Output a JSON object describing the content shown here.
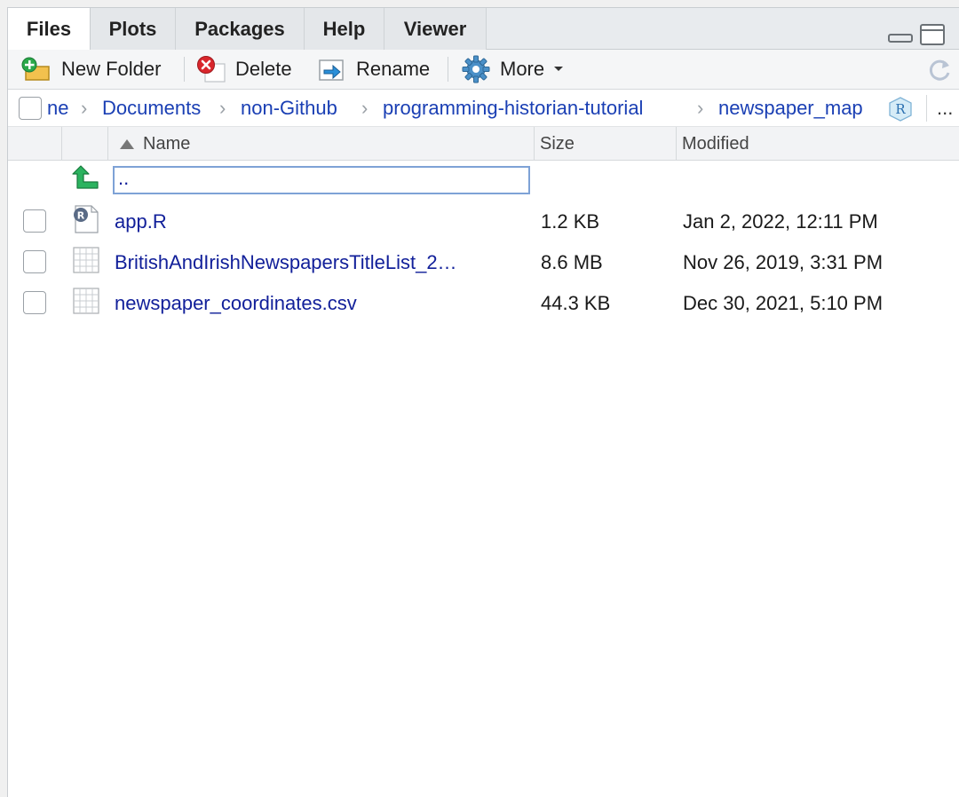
{
  "tabs": [
    {
      "label": "Files",
      "active": true
    },
    {
      "label": "Plots",
      "active": false
    },
    {
      "label": "Packages",
      "active": false
    },
    {
      "label": "Help",
      "active": false
    },
    {
      "label": "Viewer",
      "active": false
    }
  ],
  "toolbar": {
    "new_folder": "New Folder",
    "delete": "Delete",
    "rename": "Rename",
    "more": "More"
  },
  "breadcrumb": {
    "items": [
      "ne",
      "Documents",
      "non-Github",
      "programming-historian-tutorial",
      "newspaper_map"
    ],
    "overflow": "..."
  },
  "table": {
    "headers": {
      "name": "Name",
      "size": "Size",
      "modified": "Modified"
    },
    "sort_column": "Name",
    "sort_direction": "ascending",
    "parent_label": "..",
    "rows": [
      {
        "name": "app.R",
        "size": "1.2 KB",
        "modified": "Jan 2, 2022, 12:11 PM",
        "type": "r-file-icon"
      },
      {
        "name": "BritishAndIrishNewspapersTitleList_2…",
        "size": "8.6 MB",
        "modified": "Nov 26, 2019, 3:31 PM",
        "type": "table-file-icon"
      },
      {
        "name": "newspaper_coordinates.csv",
        "size": "44.3 KB",
        "modified": "Dec 30, 2021, 5:10 PM",
        "type": "table-file-icon"
      }
    ]
  },
  "colors": {
    "link": "#12209a",
    "breadcrumb_link": "#1a3fb4",
    "tab_bar": "#e8ebee",
    "up_arrow": "#1fa55a"
  }
}
